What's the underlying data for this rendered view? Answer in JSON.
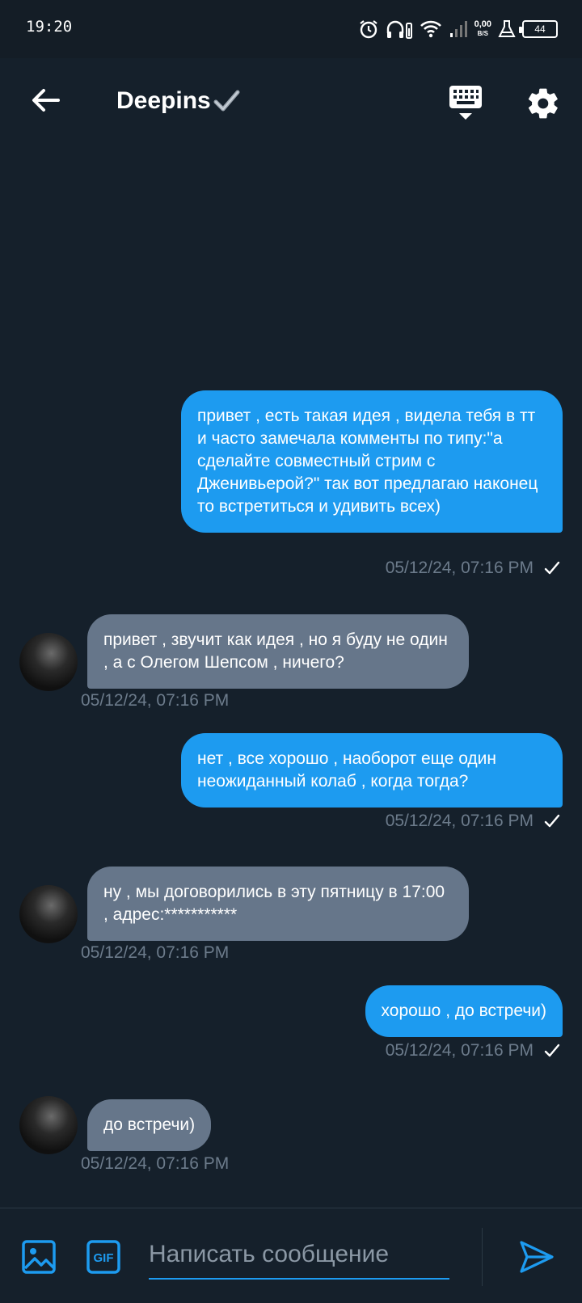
{
  "status_bar": {
    "time": "19:20",
    "net_speed": "0,00",
    "net_unit": "B/S",
    "battery": "44",
    "icons": [
      "alarm-icon",
      "headphones-icon",
      "wifi-icon",
      "signal-icon",
      "flask-icon",
      "battery-icon"
    ]
  },
  "header": {
    "title": "Deepins",
    "verified_icon": "check-mark-icon",
    "back_icon": "arrow-left-icon",
    "keyboard_icon": "keyboard-icon",
    "settings_icon": "gear-icon"
  },
  "messages": [
    {
      "direction": "out",
      "text": "привет , есть такая идея , видела тебя в тт и часто замечала комменты по типу:\"а сделайте совместный стрим с Дженивьерой?\" так вот предлагаю наконец то встретиться и удивить всех)",
      "time": "05/12/24, 07:16 PM",
      "read": true
    },
    {
      "direction": "in",
      "text": "привет , звучит как идея , но я буду не один , а с Олегом Шепсом , ничего?",
      "time": "05/12/24, 07:16 PM"
    },
    {
      "direction": "out",
      "text": "нет , все хорошо , наоборот еще один неожиданный колаб , когда тогда?",
      "time": "05/12/24, 07:16 PM",
      "read": true
    },
    {
      "direction": "in",
      "text": "ну , мы договорились в эту пятницу в 17:00 , адрес:***********",
      "time": "05/12/24, 07:16 PM"
    },
    {
      "direction": "out",
      "text": "хорошо , до встречи)",
      "time": "05/12/24, 07:16 PM",
      "read": true
    },
    {
      "direction": "in",
      "text": "до встречи)",
      "time": "05/12/24, 07:16 PM"
    }
  ],
  "composer": {
    "placeholder": "Написать сообщение",
    "image_icon": "image-icon",
    "gif_icon": "gif-icon",
    "send_icon": "send-icon"
  },
  "colors": {
    "background": "#15202b",
    "accent": "#1d9bf0",
    "incoming_bubble": "#66768a",
    "timestamp": "#6c7b8b"
  }
}
